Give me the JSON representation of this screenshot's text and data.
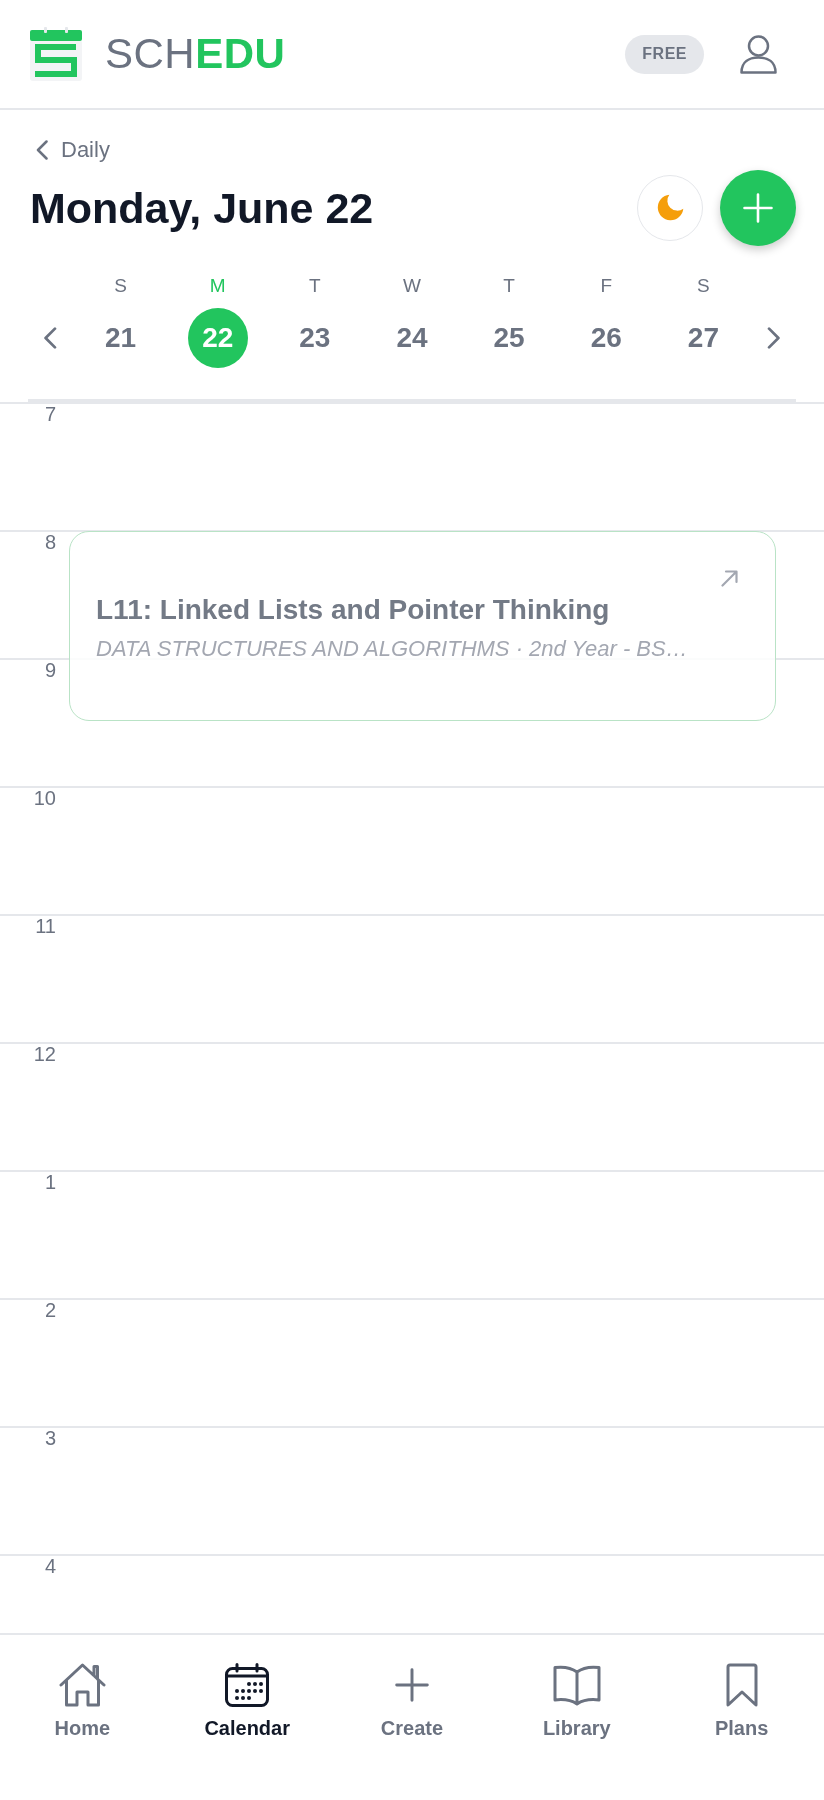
{
  "header": {
    "logo_text": "SCH**EDU**",
    "plan_badge": "FREE"
  },
  "back_link": {
    "label": "Daily"
  },
  "title": "Monday, June 22",
  "week": {
    "days": [
      {
        "letter": "S",
        "date": "21",
        "selected": false
      },
      {
        "letter": "M",
        "date": "22",
        "selected": true
      },
      {
        "letter": "T",
        "date": "23",
        "selected": false
      },
      {
        "letter": "W",
        "date": "24",
        "selected": false
      },
      {
        "letter": "T",
        "date": "25",
        "selected": false
      },
      {
        "letter": "F",
        "date": "26",
        "selected": false
      },
      {
        "letter": "S",
        "date": "27",
        "selected": false
      }
    ]
  },
  "timeline": {
    "hours": [
      {
        "label": "7"
      },
      {
        "label": "8",
        "events": [
          {
            "title": "L11: Linked Lists and Pointer Thinking",
            "subtitle": "DATA STRUCTURES AND ALGORITHMS · 2nd Year - BS…"
          }
        ]
      },
      {
        "label": "9"
      },
      {
        "label": "10"
      },
      {
        "label": "11"
      },
      {
        "label": "12"
      },
      {
        "label": "1"
      },
      {
        "label": "2"
      },
      {
        "label": "3"
      },
      {
        "label": "4"
      }
    ]
  },
  "bottom_nav": [
    {
      "kind": "home",
      "label": "Home",
      "selected": false
    },
    {
      "kind": "calendar",
      "label": "Calendar",
      "selected": true
    },
    {
      "kind": "create",
      "label": "Create",
      "selected": false
    },
    {
      "kind": "library",
      "label": "Library",
      "selected": false
    },
    {
      "kind": "plans",
      "label": "Plans",
      "selected": false
    }
  ]
}
